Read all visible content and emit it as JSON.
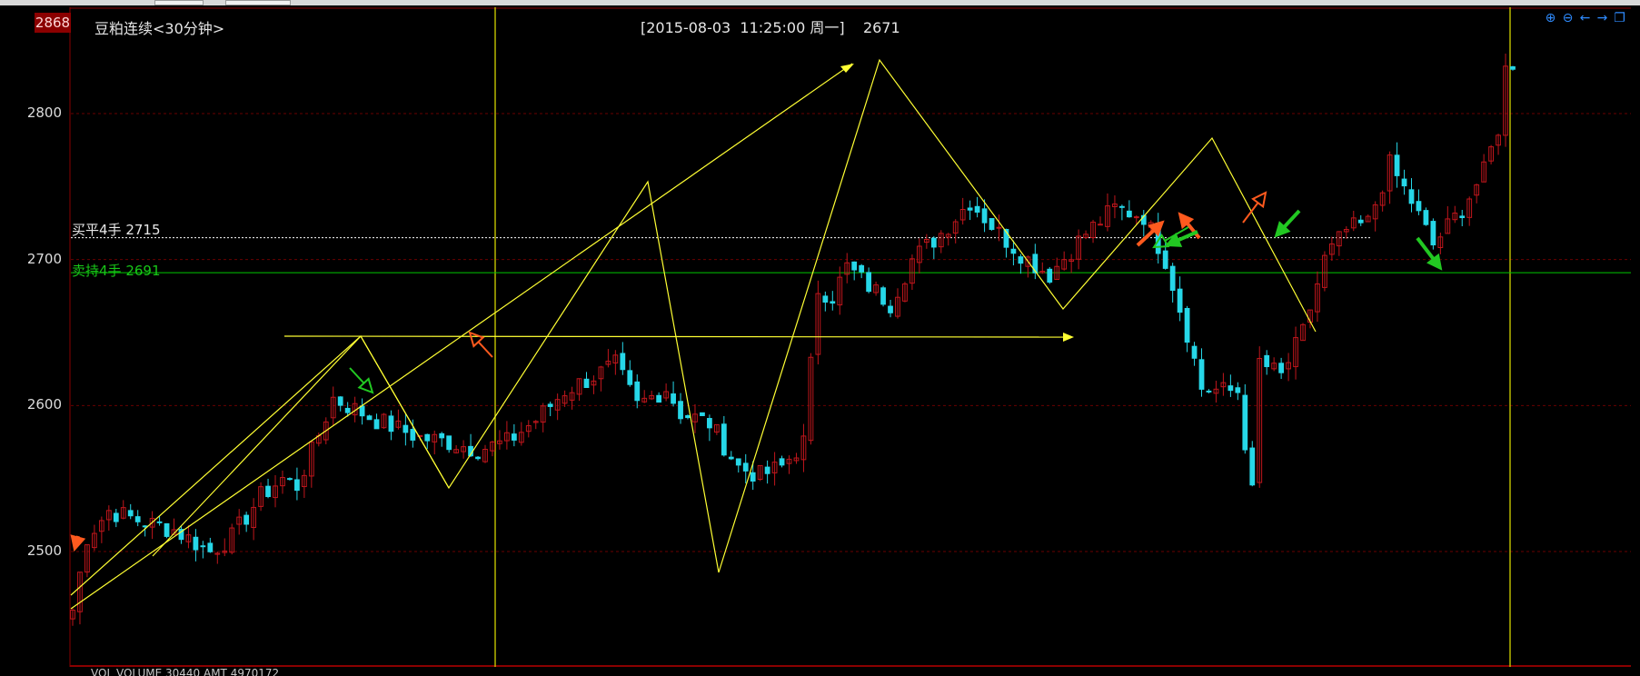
{
  "header": {
    "latest_price": "2868",
    "instrument": "豆粕连续<30分钟>",
    "crosshair_datetime": "[2015-08-03  11:25:00 周一]",
    "crosshair_price": "2671"
  },
  "toolbar": {
    "zoom_in_icon": "zoom-in-icon",
    "zoom_out_icon": "zoom-out-icon",
    "scroll_left_icon": "arrow-left-icon",
    "scroll_right_icon": "arrow-right-icon",
    "window_restore_icon": "window-restore-icon"
  },
  "bottom_bar_text": "VOL  VOLUME  30440  AMT  4970172",
  "colors": {
    "background": "#000000",
    "up_candle": "#c0161c",
    "down_candle": "#26d7e8",
    "trend_line": "#ffff33",
    "marker_vline": "#d4d400",
    "buy_close_line": "#ffffff",
    "sell_hold_line": "#00c800",
    "grid": "#6a0000",
    "buy_arrow": "#ff5a1e",
    "sell_arrow": "#22c822"
  },
  "chart_data": {
    "type": "candlestick",
    "ylim": [
      2440,
      2870
    ],
    "y_ticks": [
      2500,
      2600,
      2700,
      2800
    ],
    "grid": true,
    "bar_count": 200,
    "anchors": [
      [
        0,
        2460
      ],
      [
        2,
        2510
      ],
      [
        5,
        2528
      ],
      [
        10,
        2520
      ],
      [
        14,
        2515
      ],
      [
        19,
        2500
      ],
      [
        22,
        2510
      ],
      [
        26,
        2538
      ],
      [
        29,
        2550
      ],
      [
        31,
        2545
      ],
      [
        34,
        2580
      ],
      [
        36,
        2605
      ],
      [
        38,
        2600
      ],
      [
        42,
        2590
      ],
      [
        48,
        2578
      ],
      [
        52,
        2575
      ],
      [
        56,
        2570
      ],
      [
        60,
        2575
      ],
      [
        64,
        2590
      ],
      [
        68,
        2610
      ],
      [
        72,
        2620
      ],
      [
        75,
        2628
      ],
      [
        78,
        2600
      ],
      [
        82,
        2612
      ],
      [
        84,
        2595
      ],
      [
        88,
        2588
      ],
      [
        92,
        2558
      ],
      [
        95,
        2552
      ],
      [
        98,
        2558
      ],
      [
        101,
        2575
      ],
      [
        103,
        2680
      ],
      [
        105,
        2675
      ],
      [
        107,
        2695
      ],
      [
        110,
        2682
      ],
      [
        113,
        2670
      ],
      [
        116,
        2700
      ],
      [
        120,
        2718
      ],
      [
        124,
        2740
      ],
      [
        128,
        2718
      ],
      [
        132,
        2700
      ],
      [
        135,
        2690
      ],
      [
        140,
        2718
      ],
      [
        144,
        2735
      ],
      [
        148,
        2730
      ],
      [
        151,
        2700
      ],
      [
        154,
        2650
      ],
      [
        156,
        2612
      ],
      [
        159,
        2610
      ],
      [
        161,
        2610
      ],
      [
        163,
        2540
      ],
      [
        164,
        2630
      ],
      [
        167,
        2620
      ],
      [
        170,
        2650
      ],
      [
        173,
        2700
      ],
      [
        176,
        2720
      ],
      [
        179,
        2725
      ],
      [
        182,
        2765
      ],
      [
        185,
        2740
      ],
      [
        188,
        2710
      ],
      [
        192,
        2735
      ],
      [
        195,
        2760
      ],
      [
        197,
        2790
      ],
      [
        198,
        2830
      ],
      [
        199,
        2835
      ]
    ],
    "horizontal_lines": [
      {
        "label": "买平4手",
        "value": "2715",
        "color": "#ffffff",
        "style": "dotted"
      },
      {
        "label": "卖持4手",
        "value": "2691",
        "color": "#00c800",
        "style": "solid"
      }
    ]
  }
}
